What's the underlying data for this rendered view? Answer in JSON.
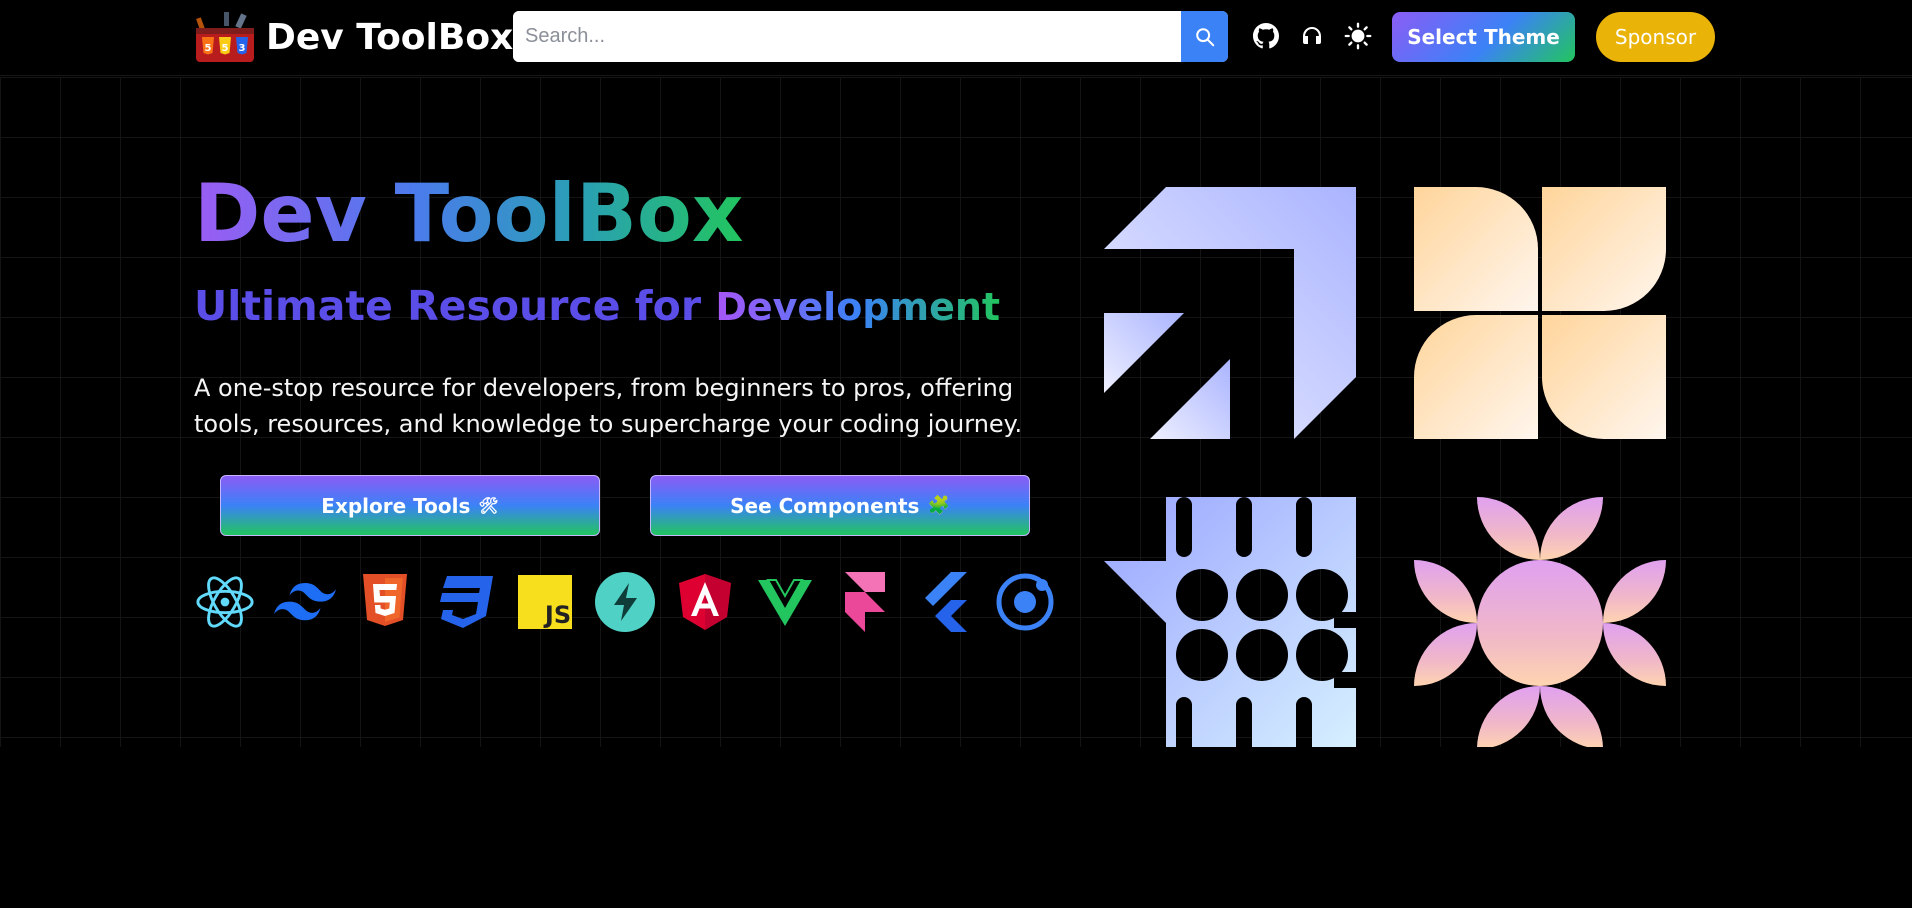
{
  "header": {
    "brand": "Dev ToolBox",
    "search_placeholder": "Search...",
    "theme_button": "Select Theme",
    "sponsor_button": "Sponsor",
    "icons": [
      "github-icon",
      "headset-icon",
      "sun-icon"
    ]
  },
  "hero": {
    "title": "Dev ToolBox",
    "subtitle_prefix": "Ultimate Resource for ",
    "subtitle_highlight": "Development",
    "description": "A one-stop resource for developers, from beginners to pros, offering tools, resources, and knowledge to supercharge your coding journey.",
    "explore_button": "Explore Tools",
    "explore_icon": "🛠",
    "components_button": "See Components",
    "components_icon": "🧩",
    "tech_icons": [
      "react-icon",
      "tailwind-icon",
      "html5-icon",
      "css3-icon",
      "javascript-icon",
      "astro-icon",
      "angular-icon",
      "vue-icon",
      "framer-icon",
      "flutter-icon",
      "ionic-icon"
    ],
    "js_badge": "JS",
    "decorations": [
      "arrow-shape",
      "clover-shape",
      "grid-circles-shape",
      "flower-shape"
    ]
  },
  "colors": {
    "accent_blue": "#3b82f6",
    "sponsor_yellow": "#eab308",
    "gradient_purple": "#8b5cf6",
    "gradient_green": "#22c55e"
  }
}
